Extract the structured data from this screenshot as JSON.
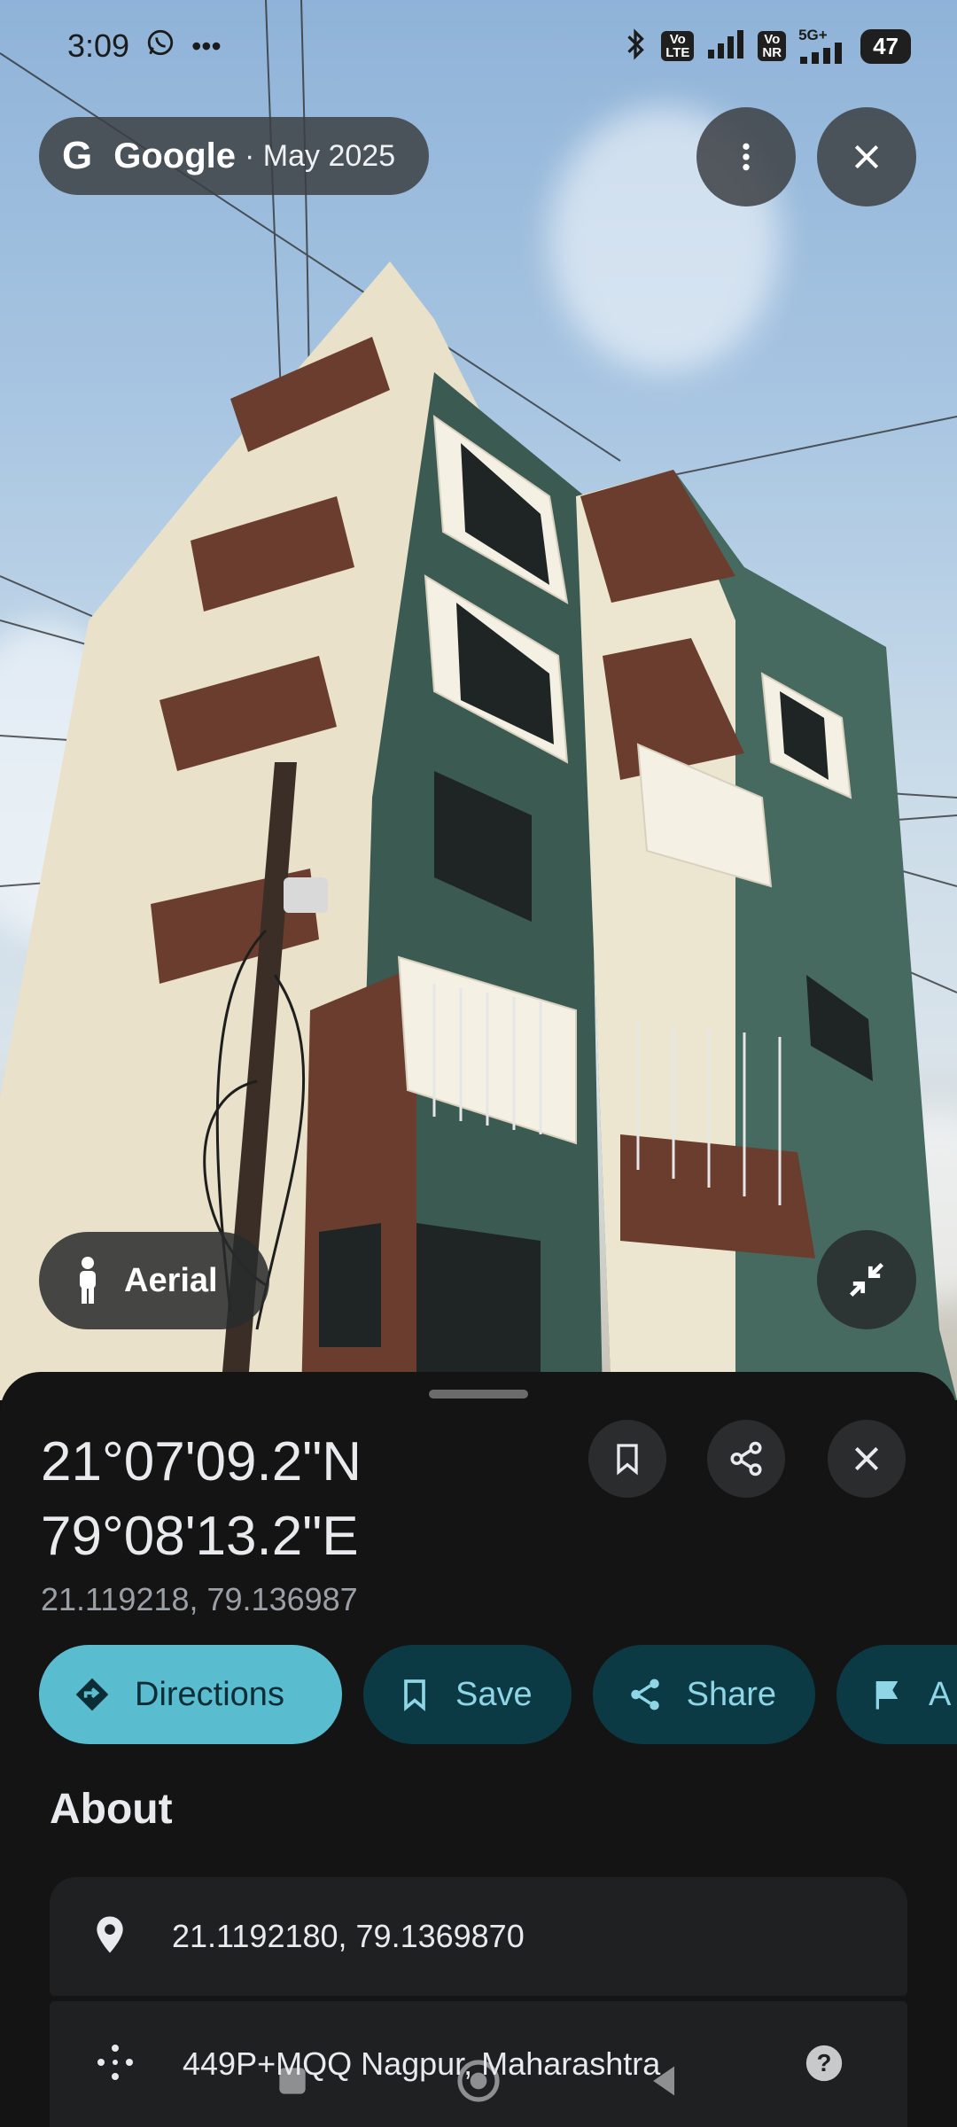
{
  "status_bar": {
    "time": "3:09",
    "whatsapp_icon": "whatsapp-icon",
    "more_icon": "ellipsis-icon",
    "volte_label": "Vo\nLTE",
    "vonr_label": "Vo\nNR",
    "network": "5G+",
    "battery": "47"
  },
  "top_bar": {
    "provider": "Google",
    "date": "· May 2025",
    "menu_icon": "more-vert-icon",
    "close_icon": "close-icon"
  },
  "overlay": {
    "aerial_label": "Aerial",
    "collapse_icon": "collapse-icon"
  },
  "place": {
    "title_line1": "21°07'09.2\"N",
    "title_line2": "79°08'13.2\"E",
    "decimal": "21.119218, 79.136987"
  },
  "actions": [
    {
      "label": "Directions",
      "icon": "directions-icon"
    },
    {
      "label": "Save",
      "icon": "bookmark-icon"
    },
    {
      "label": "Share",
      "icon": "share-icon"
    },
    {
      "label": "A",
      "icon": "flag-icon"
    }
  ],
  "about": {
    "title": "About",
    "coordinates": "21.1192180, 79.1369870",
    "plus_code": "449P+MQQ Nagpur, Maharashtra"
  },
  "colors": {
    "accent": "#59bccf",
    "chip_bg": "#0b3a44",
    "sheet_bg": "#141414"
  }
}
